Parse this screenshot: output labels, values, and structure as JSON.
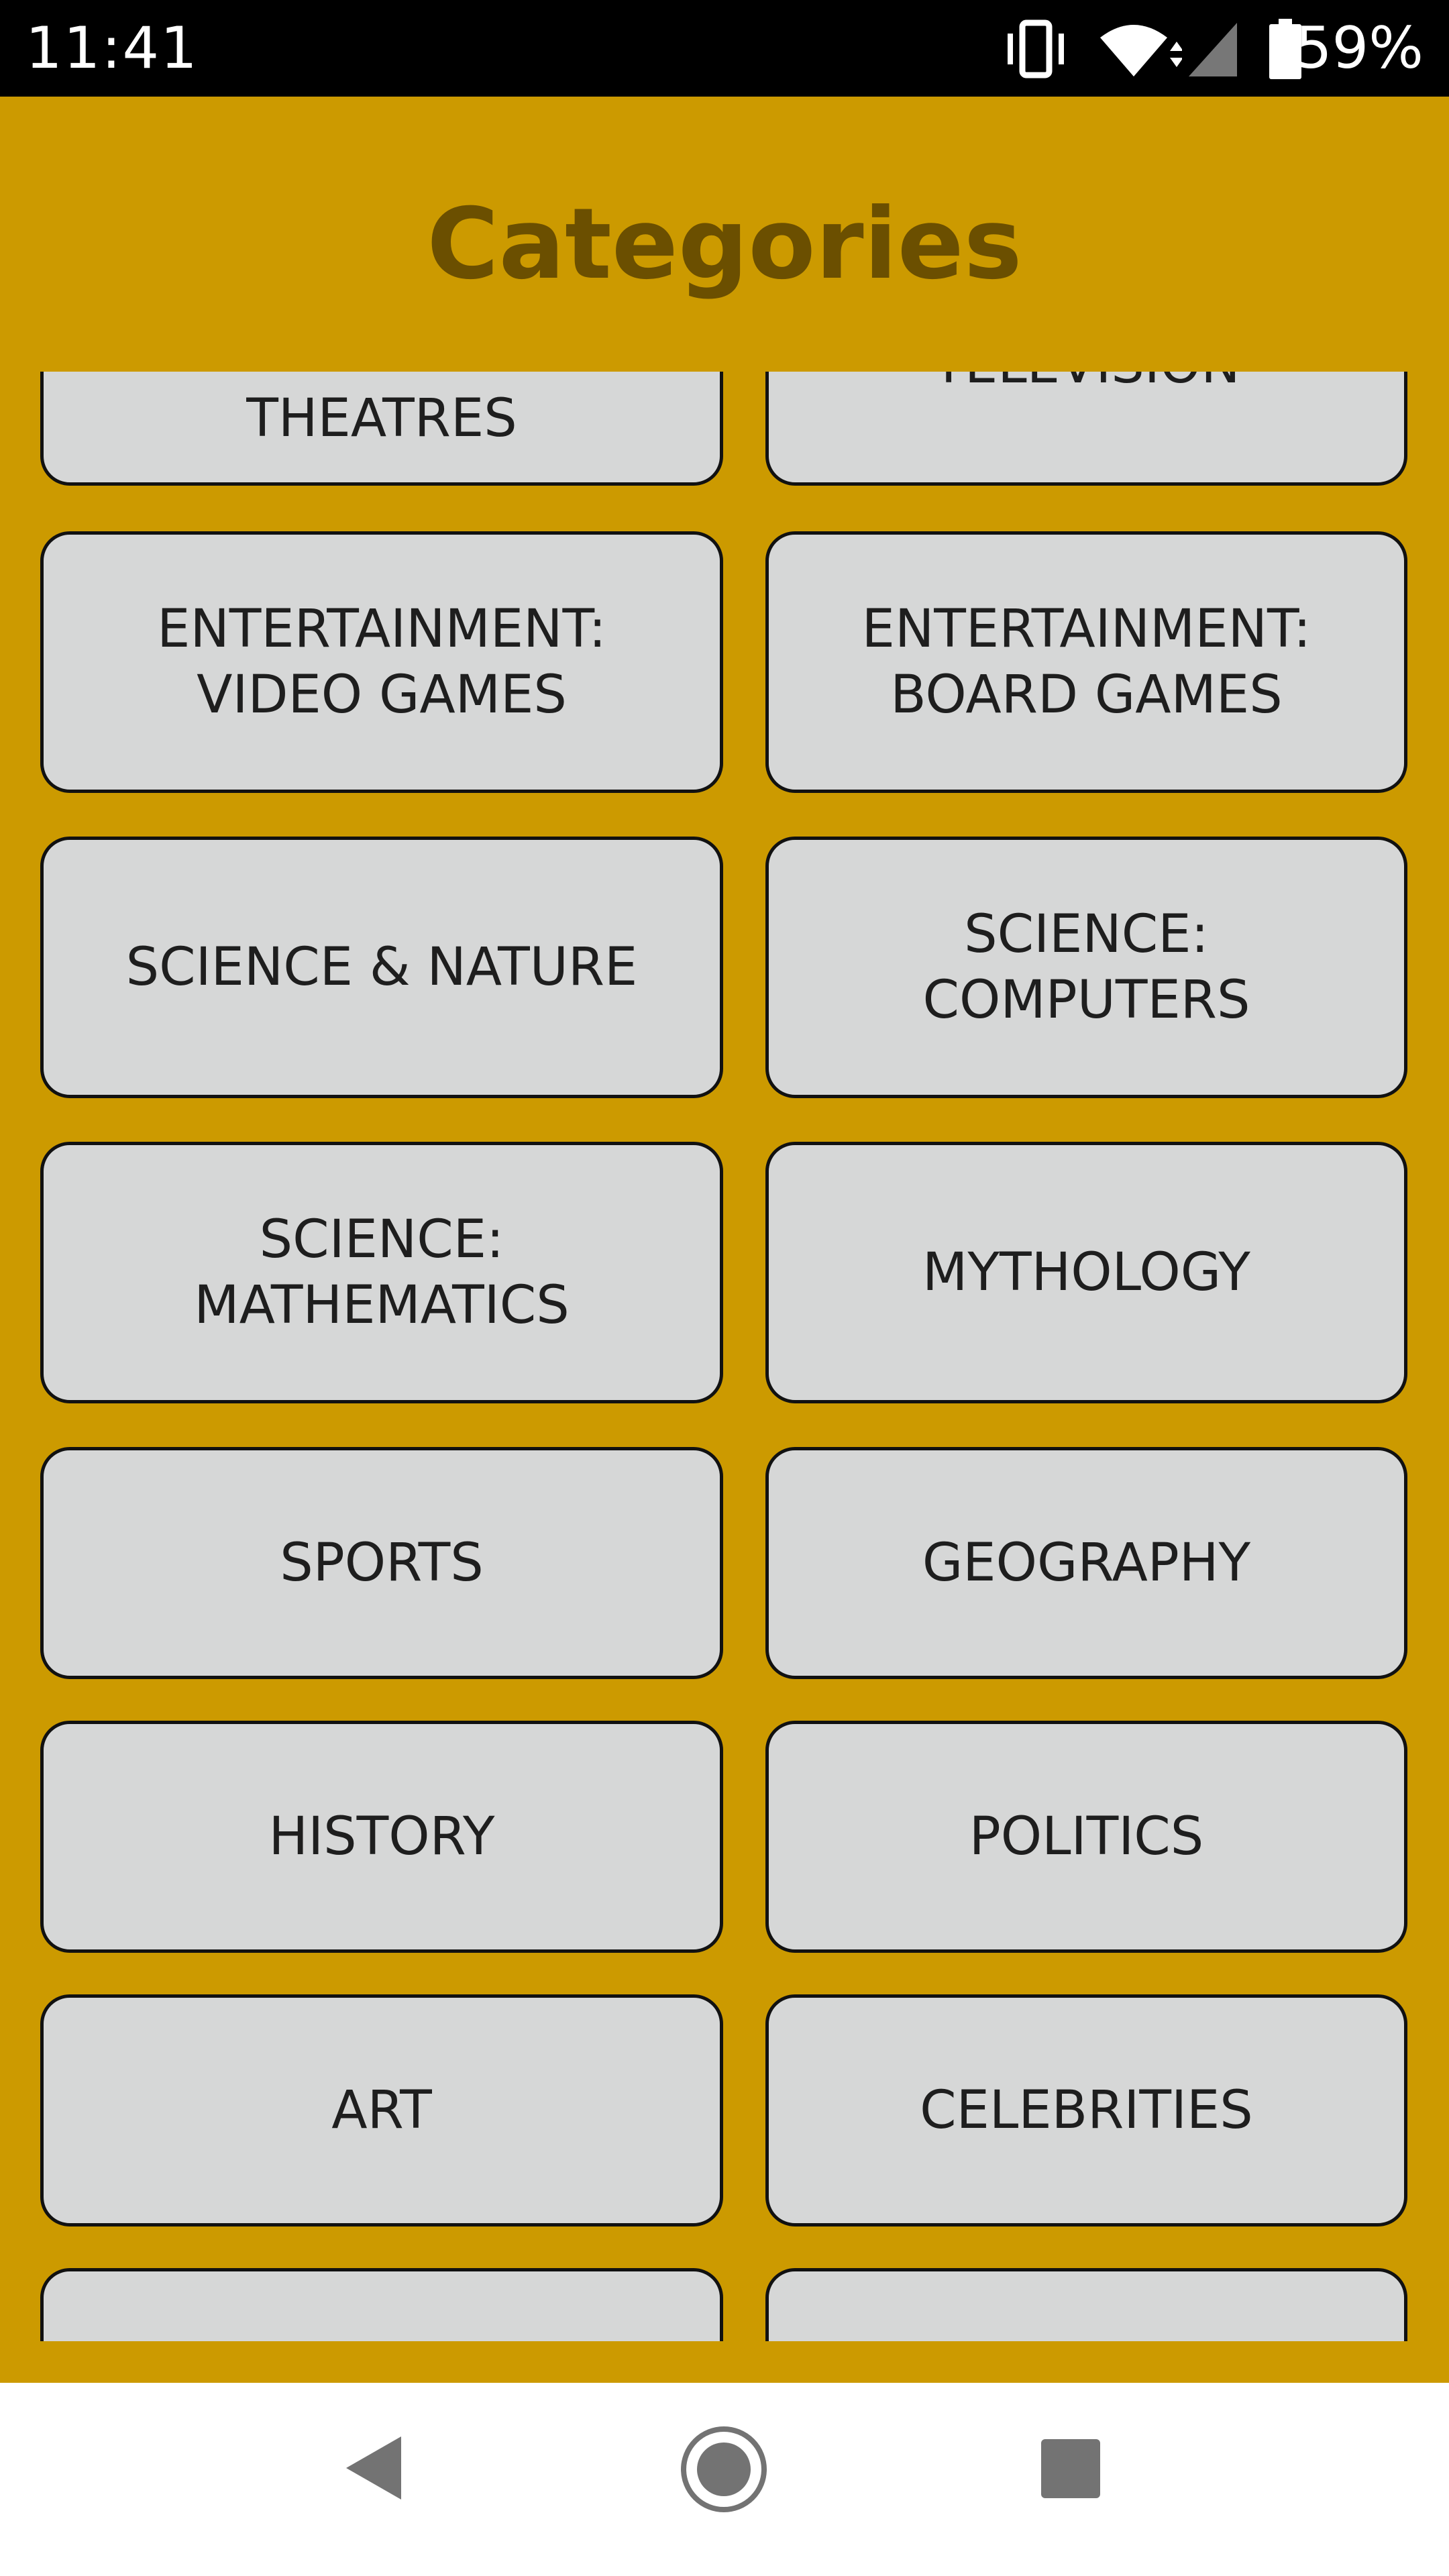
{
  "status_bar": {
    "time": "11:41",
    "battery_percent": "59%",
    "icons": [
      "vibrate-icon",
      "wifi-icon",
      "cell-signal-icon",
      "battery-icon"
    ]
  },
  "header": {
    "title": "Categories"
  },
  "categories": {
    "row0": {
      "left": "THEATRES",
      "right": "TELEVISION"
    },
    "row1": {
      "left": "ENTERTAINMENT:\nVIDEO GAMES",
      "right": "ENTERTAINMENT:\nBOARD GAMES"
    },
    "row2": {
      "left": "SCIENCE & NATURE",
      "right": "SCIENCE:\nCOMPUTERS"
    },
    "row3": {
      "left": "SCIENCE:\nMATHEMATICS",
      "right": "MYTHOLOGY"
    },
    "row4": {
      "left": "SPORTS",
      "right": "GEOGRAPHY"
    },
    "row5": {
      "left": "HISTORY",
      "right": "POLITICS"
    },
    "row6": {
      "left": "ART",
      "right": "CELEBRITIES"
    },
    "row7": {
      "left": "",
      "right": ""
    }
  },
  "nav_bar": {
    "icons": [
      "back-icon",
      "home-icon",
      "recents-icon"
    ]
  },
  "colors": {
    "background": "#cc9a00",
    "title": "#6b4f00",
    "button_fill": "#d6d7d7",
    "button_border": "#111111"
  }
}
